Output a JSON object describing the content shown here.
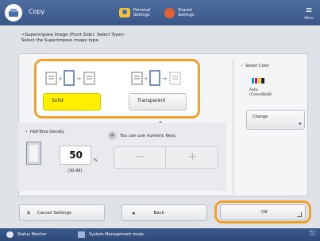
{
  "header": {
    "app_title": "Copy",
    "personal_settings": "Personal Settings",
    "shared_settings": "Shared Settings",
    "menu_label": "Menu"
  },
  "instruction": {
    "line1": "<Superimpose Image (Front Side): Select Type>",
    "line2": "Select the Superimpose image type."
  },
  "types": {
    "solid_label": "Solid",
    "transparent_label": "Transparent",
    "selected": "Solid"
  },
  "select_color": {
    "label": "Select Color",
    "value": "Auto (Color/B&W)",
    "change_label": "Change"
  },
  "halftone": {
    "label": "Half-Tone Density",
    "hint": "You can use numeric keys.",
    "value": "50",
    "unit": "%",
    "range": "(30-99)",
    "minus": "−",
    "plus": "+"
  },
  "actions": {
    "cancel_label": "Cancel Settings",
    "back_label": "Back",
    "ok_label": "OK"
  },
  "status_bar": {
    "status_monitor": "Status Monitor",
    "system_mode": "System Management mode."
  },
  "colors": {
    "header": "#4a6a9c",
    "selected_yellow": "#ffef00",
    "highlight_orange": "#f2a02c"
  }
}
